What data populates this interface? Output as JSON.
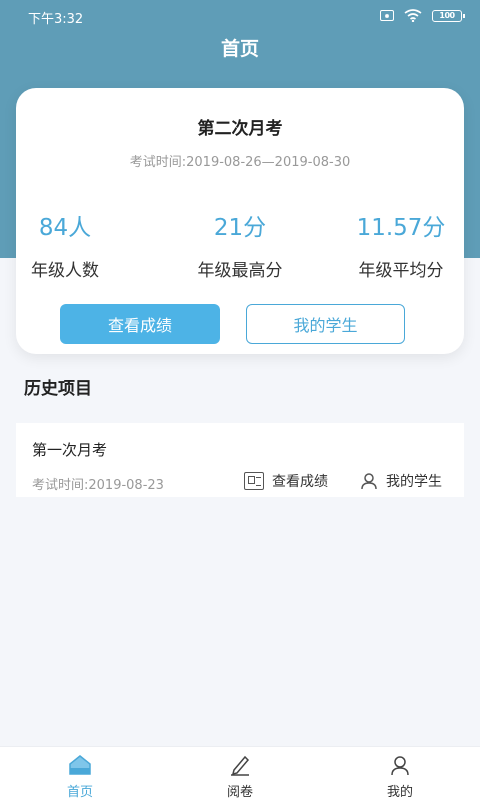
{
  "status_bar": {
    "time": "下午3:32",
    "battery": "100"
  },
  "header": {
    "title": "首页"
  },
  "current_exam": {
    "name": "第二次月考",
    "time": "考试时间:2019-08-26—2019-08-30",
    "stats": [
      {
        "value": "84人",
        "label": "年级人数"
      },
      {
        "value": "21分",
        "label": "年级最高分"
      },
      {
        "value": "11.57分",
        "label": "年级平均分"
      }
    ],
    "view_scores_label": "查看成绩",
    "my_students_label": "我的学生"
  },
  "history": {
    "title": "历史项目",
    "items": [
      {
        "name": "第一次月考",
        "time": "考试时间:2019-08-23",
        "view_scores_label": "查看成绩",
        "my_students_label": "我的学生"
      }
    ]
  },
  "tabbar": {
    "items": [
      {
        "label": "首页",
        "icon": "home-icon"
      },
      {
        "label": "阅卷",
        "icon": "pen-icon"
      },
      {
        "label": "我的",
        "icon": "user-icon"
      }
    ],
    "active_color": "#4aa8d8"
  },
  "colors": {
    "header": "#5f9db7",
    "accent": "#4aa8d8",
    "button": "#4db3e6"
  }
}
